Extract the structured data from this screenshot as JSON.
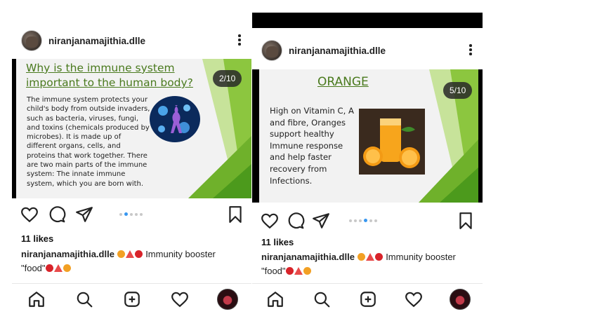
{
  "posts": [
    {
      "username": "niranjanamajithia.dlle",
      "slide": {
        "counter": "2/10",
        "title_line1": "Why is the immune system",
        "title_line2": "important to the human body?",
        "body": "The immune system protects your child's body from outside invaders, such as bacteria, viruses, fungi, and toxins (chemicals produced by microbes). It is made up of different organs, cells, and proteins that work together. There are two main parts of the immune system: The innate immune system, which you are born with."
      },
      "carousel": {
        "total": 5,
        "active": 2
      },
      "likes": "11 likes",
      "caption_user": "niranjanamajithia.dlle",
      "caption_text": "Immunity booster",
      "caption_line2": "\"food\""
    },
    {
      "username": "niranjanamajithia.dlle",
      "slide": {
        "counter": "5/10",
        "title": "ORANGE",
        "body": "High on Vitamin C, A and fibre, Oranges support healthy Immune response and help faster recovery from Infections."
      },
      "carousel": {
        "total": 6,
        "active": 4
      },
      "likes": "11 likes",
      "caption_user": "niranjanamajithia.dlle",
      "caption_text": "Immunity booster",
      "caption_line2": "\"food\""
    }
  ],
  "icons": [
    "heart-icon",
    "comment-icon",
    "share-icon",
    "bookmark-icon",
    "home-icon",
    "search-icon",
    "add-icon",
    "activity-icon"
  ],
  "colors": {
    "link": "#3897f0",
    "title_green": "#4a7a1e",
    "slide_green": "#8cc63f",
    "emoji_orange": "#f2a024",
    "emoji_red": "#d8232a"
  }
}
